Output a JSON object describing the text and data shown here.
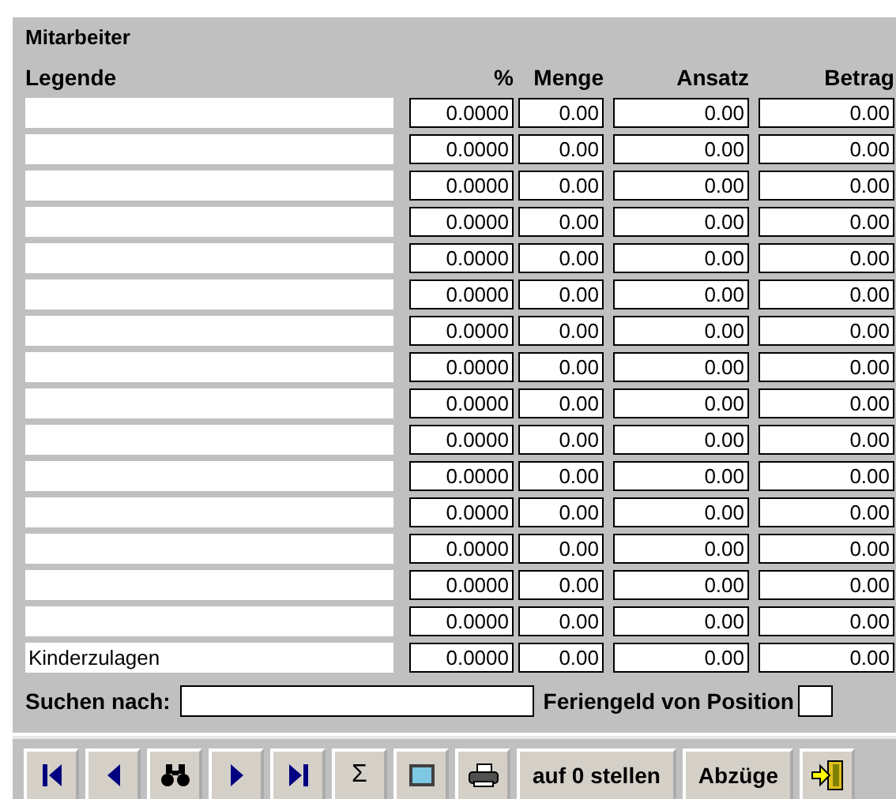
{
  "section_title": "Mitarbeiter",
  "columns": [
    "Legende",
    "%",
    "Menge",
    "Ansatz",
    "Betrag"
  ],
  "rows": [
    {
      "percent": "0.0000",
      "menge": "0.00",
      "ansatz": "0.00",
      "betrag": "0.00"
    },
    {
      "percent": "0.0000",
      "menge": "0.00",
      "ansatz": "0.00",
      "betrag": "0.00"
    },
    {
      "percent": "0.0000",
      "menge": "0.00",
      "ansatz": "0.00",
      "betrag": "0.00"
    },
    {
      "percent": "0.0000",
      "menge": "0.00",
      "ansatz": "0.00",
      "betrag": "0.00"
    },
    {
      "percent": "0.0000",
      "menge": "0.00",
      "ansatz": "0.00",
      "betrag": "0.00"
    },
    {
      "percent": "0.0000",
      "menge": "0.00",
      "ansatz": "0.00",
      "betrag": "0.00"
    },
    {
      "percent": "0.0000",
      "menge": "0.00",
      "ansatz": "0.00",
      "betrag": "0.00"
    },
    {
      "percent": "0.0000",
      "menge": "0.00",
      "ansatz": "0.00",
      "betrag": "0.00"
    },
    {
      "percent": "0.0000",
      "menge": "0.00",
      "ansatz": "0.00",
      "betrag": "0.00"
    },
    {
      "percent": "0.0000",
      "menge": "0.00",
      "ansatz": "0.00",
      "betrag": "0.00"
    },
    {
      "percent": "0.0000",
      "menge": "0.00",
      "ansatz": "0.00",
      "betrag": "0.00"
    },
    {
      "percent": "0.0000",
      "menge": "0.00",
      "ansatz": "0.00",
      "betrag": "0.00"
    },
    {
      "percent": "0.0000",
      "menge": "0.00",
      "ansatz": "0.00",
      "betrag": "0.00"
    },
    {
      "percent": "0.0000",
      "menge": "0.00",
      "ansatz": "0.00",
      "betrag": "0.00"
    },
    {
      "percent": "0.0000",
      "menge": "0.00",
      "ansatz": "0.00",
      "betrag": "0.00"
    },
    {
      "legende": "Kinderzulagen",
      "percent": "0.0000",
      "menge": "0.00",
      "ansatz": "0.00",
      "betrag": "0.00"
    }
  ],
  "search": {
    "label": "Suchen nach:"
  },
  "feriengeld": {
    "label": "Feriengeld von Position"
  },
  "toolbar": [
    {
      "kind": "first"
    },
    {
      "kind": "prev"
    },
    {
      "kind": "find"
    },
    {
      "kind": "next"
    },
    {
      "kind": "last"
    },
    {
      "kind": "sum",
      "label": "Σ"
    },
    {
      "kind": "screen"
    },
    {
      "kind": "print"
    },
    {
      "kind": "text",
      "label": "auf 0 stellen"
    },
    {
      "kind": "text",
      "label": "Abzüge"
    },
    {
      "kind": "exit"
    }
  ]
}
